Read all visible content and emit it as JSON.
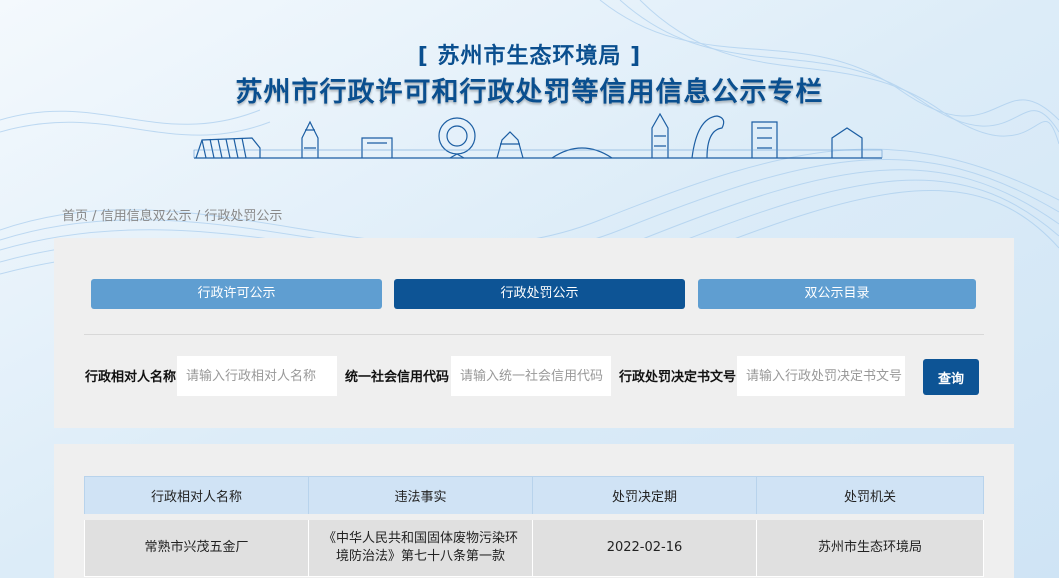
{
  "header": {
    "org_title": "[ 苏州市生态环境局 ]",
    "main_title": "苏州市行政许可和行政处罚等信用信息公示专栏"
  },
  "breadcrumb": {
    "home": "首页",
    "sep1": " / ",
    "level2": "信用信息双公示",
    "sep2": " / ",
    "current": "行政处罚公示"
  },
  "tabs": [
    {
      "label": "行政许可公示",
      "active": false
    },
    {
      "label": "行政处罚公示",
      "active": true
    },
    {
      "label": "双公示目录",
      "active": false
    }
  ],
  "search": {
    "name_label": "行政相对人名称",
    "name_placeholder": "请输入行政相对人名称",
    "code_label": "统一社会信用代码",
    "code_placeholder": "请输入统一社会信用代码",
    "doc_label": "行政处罚决定书文号",
    "doc_placeholder": "请输入行政处罚决定书文号",
    "query_label": "查询"
  },
  "table": {
    "columns": [
      "行政相对人名称",
      "违法事实",
      "处罚决定期",
      "处罚机关"
    ],
    "rows": [
      [
        "常熟市兴茂五金厂",
        "《中华人民共和国固体废物污染环境防治法》第七十八条第一款",
        "2022-02-16",
        "苏州市生态环境局"
      ]
    ]
  },
  "colors": {
    "primary": "#0d5495",
    "tab_inactive": "#5f9ed1",
    "title": "#0a4f8f"
  }
}
